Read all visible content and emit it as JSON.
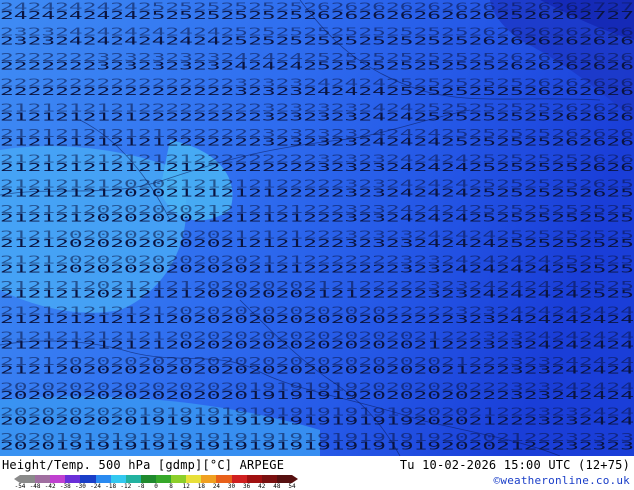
{
  "map": {
    "parameter": "Height/Temp. 500 hPa [gdmp][°C]",
    "model": "ARPEGE",
    "number_rows": [
      "2424242424252525252525262626262626262526262727",
      "2323242424242424252525252525252525262626262626",
      "2222222323232323242424252525252525252626262626",
      "2222222222222222232323242424252525252526262626",
      "2121212121222222222323232324242525252525262626",
      "2121212121212222222323232324242425252525262626",
      "2121212121212122222222232323242424252525252626",
      "2121212120202121212122222323242424252525252625",
      "2121212020202021212121222323242424252525252525",
      "2121202020202020212121222323232424242525252525",
      "2121202020202020202121222222232324242424252525",
      "2121212021212120202020212122222323242424242525",
      "2121212121212020202020202020222223232424242424",
      "2121212121212020202020202020202122232324242424",
      "2121202020202020202020202020202021222323242424",
      "2020202020202020201919191920202020222323242424",
      "2020202020191919191919191919192020212223232424",
      "2020191919191919191919191919191920202122232323"
    ]
  },
  "footer": {
    "title_left": "Height/Temp. 500 hPa [gdmp][°C] ARPEGE",
    "title_right": "Tu 10-02-2026 15:00 UTC (12+75)",
    "credit": "©weatheronline.co.uk"
  },
  "legend": {
    "ticks": [
      "-54",
      "-48",
      "-42",
      "-38",
      "-30",
      "-24",
      "-18",
      "-12",
      "-8",
      "0",
      "8",
      "12",
      "18",
      "24",
      "30",
      "36",
      "42",
      "48",
      "54"
    ],
    "colors": [
      "#8a8a8a",
      "#a06ea0",
      "#c040d0",
      "#6a2fd8",
      "#1a3ec8",
      "#2a8af0",
      "#33c8f0",
      "#22b2a0",
      "#1f8a2e",
      "#36a82a",
      "#8ccf2a",
      "#e8e03a",
      "#f0a020",
      "#e8601a",
      "#d02020",
      "#a01010",
      "#7a1010",
      "#561010"
    ]
  }
}
